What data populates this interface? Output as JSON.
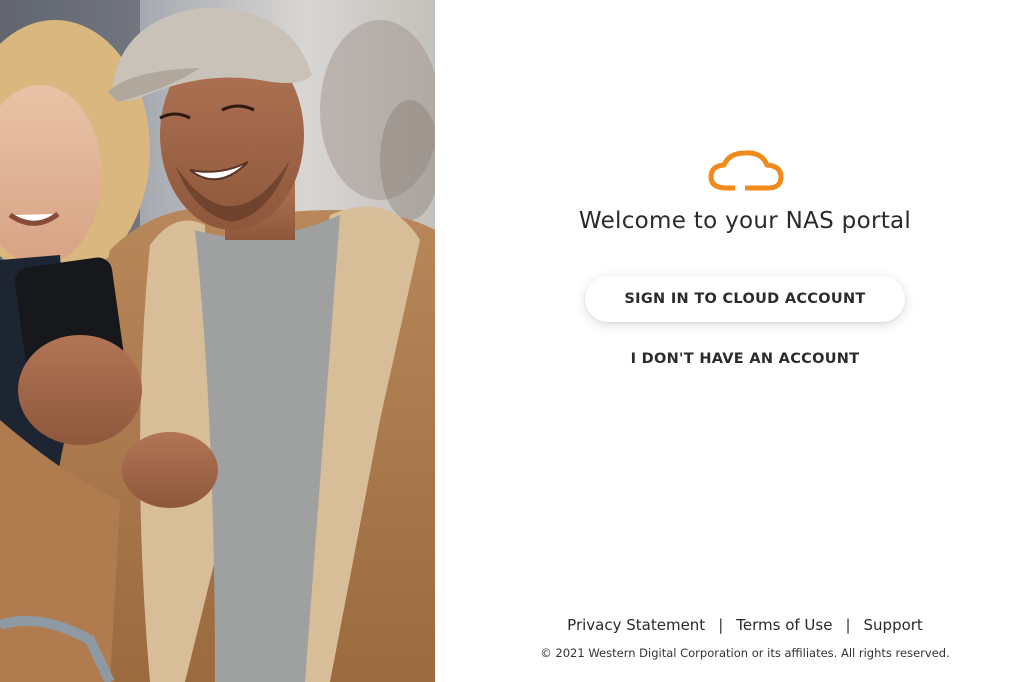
{
  "hero": {
    "image_description": "hero-photo"
  },
  "logo": {
    "icon": "cloud-icon",
    "color": "#f08a1c"
  },
  "main": {
    "title": "Welcome to your NAS portal",
    "signin_label": "SIGN IN TO CLOUD ACCOUNT",
    "no_account_label": "I DON'T HAVE AN ACCOUNT"
  },
  "footer": {
    "privacy_label": "Privacy Statement",
    "terms_label": "Terms of Use",
    "support_label": "Support",
    "separator": "|",
    "copyright": "© 2021 Western Digital Corporation or its affiliates. All rights reserved."
  }
}
